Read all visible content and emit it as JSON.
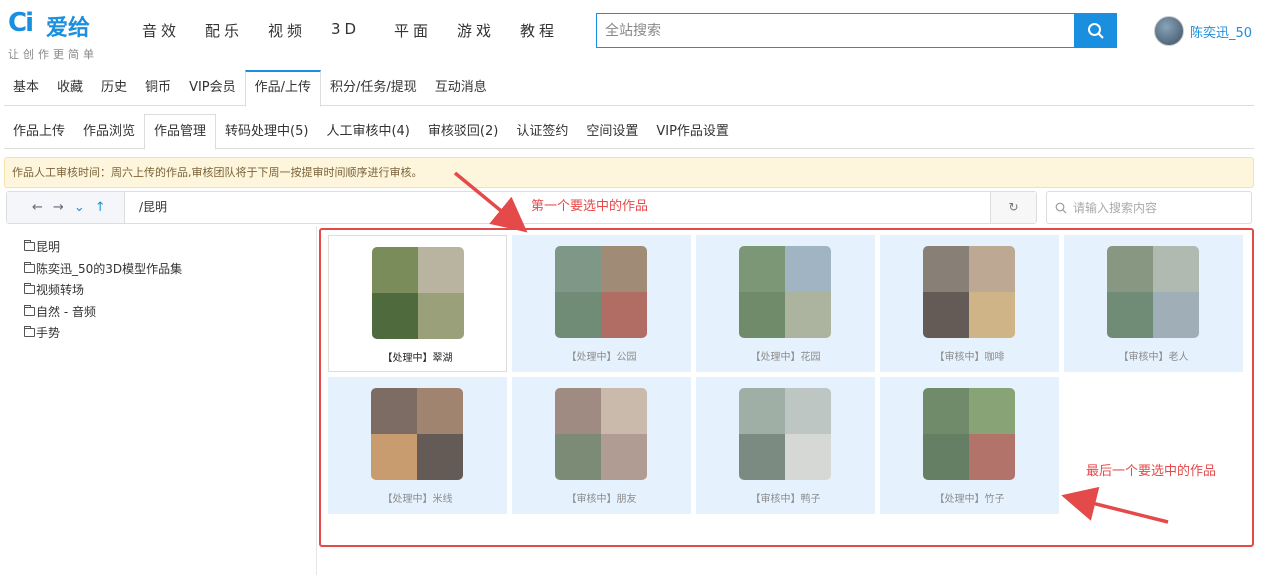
{
  "header": {
    "logo_mark": "Ci",
    "logo_text": "爱给",
    "slogan": "让创作更简单",
    "nav": [
      "音效",
      "配乐",
      "视频",
      "3D",
      "平面",
      "游戏",
      "教程"
    ],
    "search_placeholder": "全站搜索",
    "username": "陈奕迅_50"
  },
  "tabs_main": [
    {
      "label": "基本"
    },
    {
      "label": "收藏"
    },
    {
      "label": "历史"
    },
    {
      "label": "铜币"
    },
    {
      "label": "VIP会员"
    },
    {
      "label": "作品/上传",
      "active": true
    },
    {
      "label": "积分/任务/提现"
    },
    {
      "label": "互动消息"
    }
  ],
  "tabs_sub": [
    {
      "label": "作品上传"
    },
    {
      "label": "作品浏览"
    },
    {
      "label": "作品管理",
      "active": true
    },
    {
      "label": "转码处理中(5)"
    },
    {
      "label": "人工审核中(4)"
    },
    {
      "label": "审核驳回(2)"
    },
    {
      "label": "认证签约"
    },
    {
      "label": "空间设置"
    },
    {
      "label": "VIP作品设置"
    }
  ],
  "notice": "作品人工审核时间：周六上传的作品,审核团队将于下周一按提审时间顺序进行审核。",
  "path": {
    "current": "/昆明",
    "search_placeholder": "请输入搜索内容"
  },
  "folders": [
    "昆明",
    "陈奕迅_50的3D模型作品集",
    "视频转场",
    "自然 - 音频",
    "手势"
  ],
  "works": [
    {
      "label": "【处理中】翠湖",
      "selected": false,
      "colors": [
        "#7a8c5a",
        "#b8b4a0",
        "#4f6a3c",
        "#9aa07a"
      ]
    },
    {
      "label": "【处理中】公园",
      "selected": true,
      "colors": [
        "#5c7a60",
        "#8a6a4a",
        "#4a6a4a",
        "#a04030"
      ]
    },
    {
      "label": "【处理中】花园",
      "selected": true,
      "colors": [
        "#5a7a4a",
        "#8aa0b0",
        "#4a6a3a",
        "#9aa080"
      ]
    },
    {
      "label": "【审核中】咖啡",
      "selected": true,
      "colors": [
        "#6a5a4a",
        "#b09070",
        "#3a2a20",
        "#c8a060"
      ]
    },
    {
      "label": "【审核中】老人",
      "selected": true,
      "colors": [
        "#6a7a5a",
        "#a0a898",
        "#4a6a4a",
        "#8898a0"
      ]
    },
    {
      "label": "【处理中】米线",
      "selected": true,
      "colors": [
        "#5a4030",
        "#8a6040",
        "#c08040",
        "#3a2a20"
      ]
    },
    {
      "label": "【审核中】朋友",
      "selected": true,
      "colors": [
        "#8a6a5a",
        "#c0a890",
        "#5a6a4a",
        "#a08070"
      ]
    },
    {
      "label": "【审核中】鸭子",
      "selected": true,
      "colors": [
        "#8a9a8a",
        "#b0b8b0",
        "#5a6a5a",
        "#d0d0c8"
      ]
    },
    {
      "label": "【处理中】竹子",
      "selected": true,
      "colors": [
        "#4a6a3a",
        "#6a8a4a",
        "#3a5a30",
        "#a04a3a"
      ]
    }
  ],
  "annotations": {
    "first": "第一个要选中的作品",
    "last": "最后一个要选中的作品"
  },
  "colors": {
    "accent": "#1a8fe0",
    "selected_bg": "#e5f1fc",
    "annotation": "#e54a4a",
    "notice_bg": "#fdf6dd"
  }
}
